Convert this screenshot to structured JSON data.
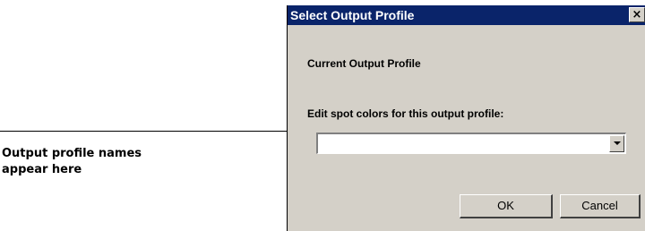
{
  "callout": {
    "line1": "Output profile names",
    "line2": "appear here"
  },
  "dialog": {
    "title": "Select Output Profile",
    "close_label": "×",
    "current_profile_label": "Current Output Profile",
    "edit_spot_label": "Edit spot colors for this output profile:",
    "profile_select": {
      "selected_value": ""
    },
    "ok_label": "OK",
    "cancel_label": "Cancel"
  },
  "colors": {
    "titlebar": "#0a246a",
    "dialog_bg": "#d4d0c8"
  },
  "icons": {
    "close": "close-icon",
    "dropdown": "chevron-down-icon"
  }
}
